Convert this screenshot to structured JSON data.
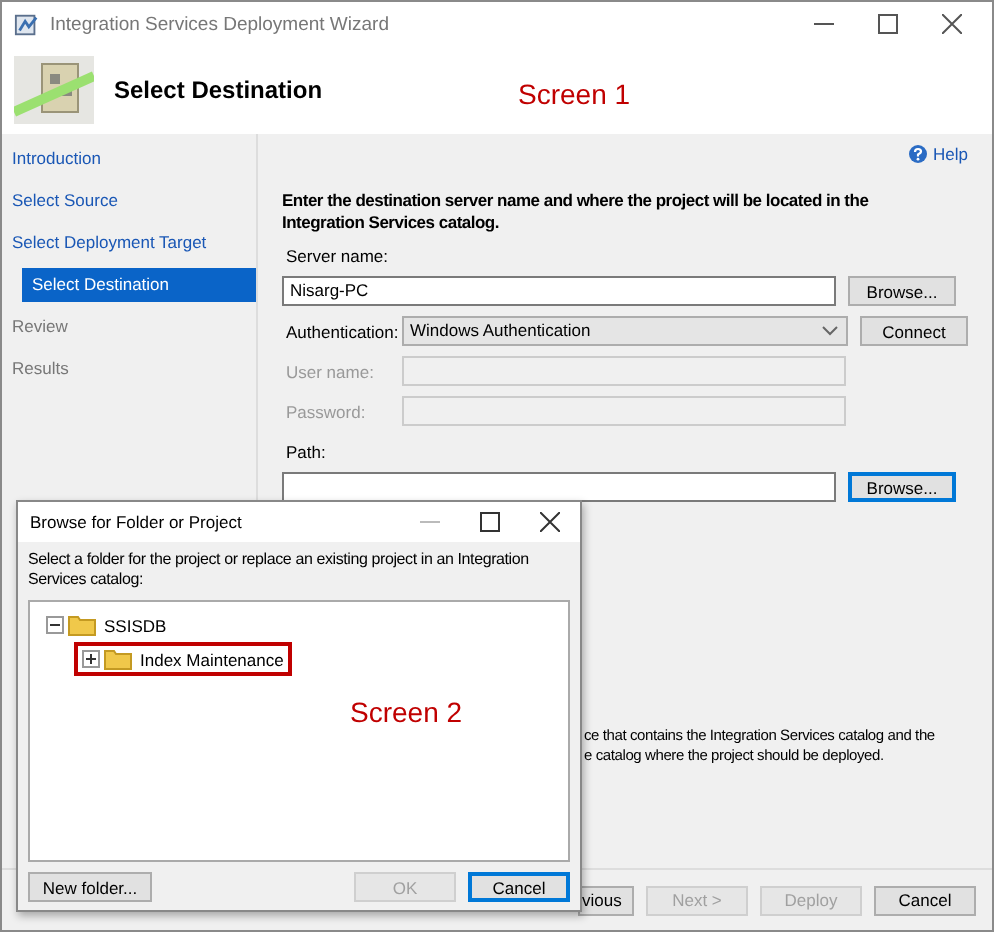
{
  "window": {
    "title": "Integration Services Deployment Wizard"
  },
  "header": {
    "title": "Select Destination",
    "annotation": "Screen 1"
  },
  "nav": [
    {
      "label": "Introduction",
      "selected": false,
      "disabled": false
    },
    {
      "label": "Select Source",
      "selected": false,
      "disabled": false
    },
    {
      "label": "Select Deployment Target",
      "selected": false,
      "disabled": false,
      "children": [
        {
          "label": "Select Destination",
          "selected": true,
          "disabled": false
        }
      ]
    },
    {
      "label": "Review",
      "selected": false,
      "disabled": true
    },
    {
      "label": "Results",
      "selected": false,
      "disabled": true
    }
  ],
  "help": "Help",
  "instruction": "Enter the destination server name and where the project will be located in the Integration Services catalog.",
  "form": {
    "server_name": {
      "label": "Server name:",
      "value": "Nisarg-PC",
      "button": "Browse..."
    },
    "authentication": {
      "label": "Authentication:",
      "value": "Windows Authentication",
      "button": "Connect"
    },
    "user_name": {
      "label": "User name:",
      "disabled": true
    },
    "password": {
      "label": "Password:",
      "disabled": true
    },
    "path": {
      "label": "Path:",
      "button": "Browse...",
      "button_focused": true
    }
  },
  "description_lines": [
    "ce that contains the Integration Services catalog and the",
    "e catalog where the project should be deployed."
  ],
  "footer_buttons": [
    {
      "label": "vious",
      "disabled": false
    },
    {
      "label": "Next >",
      "disabled": true
    },
    {
      "label": "Deploy",
      "disabled": true
    },
    {
      "label": "Cancel",
      "disabled": false
    }
  ],
  "dialog": {
    "title": "Browse for Folder or Project",
    "annotation": "Screen 2",
    "description": "Select a folder for the project or replace an existing project in an Integration Services catalog:",
    "tree": [
      {
        "label": "SSISDB",
        "expanded": true,
        "highlighted": false,
        "children": [
          {
            "label": "Index Maintenance",
            "expanded": false,
            "highlighted": true
          }
        ]
      }
    ],
    "buttons": [
      {
        "label": "New folder...",
        "disabled": false,
        "focused": false
      },
      {
        "label": "OK",
        "disabled": true,
        "focused": false
      },
      {
        "label": "Cancel",
        "disabled": false,
        "focused": true
      }
    ]
  }
}
